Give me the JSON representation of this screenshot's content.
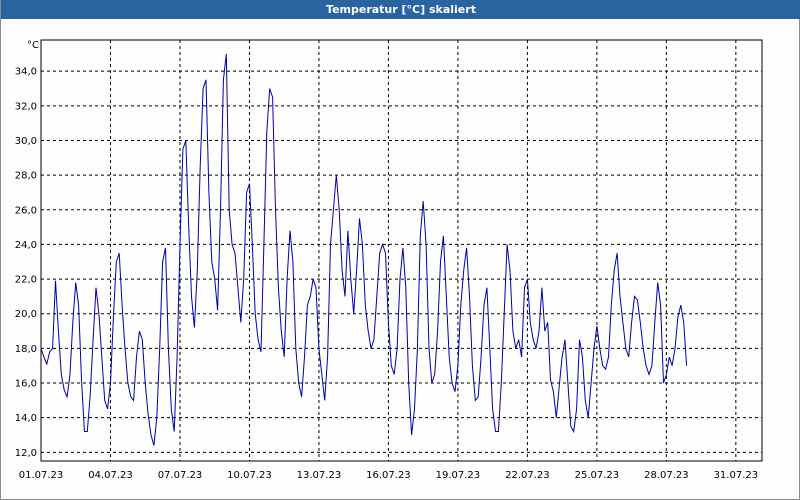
{
  "window": {
    "title": "Temperatur [°C] skaliert"
  },
  "chart_data": {
    "type": "line",
    "title": "Temperatur [°C] skaliert",
    "ylabel": "°C",
    "xlabel": "",
    "ylim": [
      11.5,
      35.8
    ],
    "grid": true,
    "x_ticks": [
      "01.07.23",
      "04.07.23",
      "07.07.23",
      "10.07.23",
      "13.07.23",
      "16.07.23",
      "19.07.23",
      "22.07.23",
      "25.07.23",
      "28.07.23",
      "31.07.23"
    ],
    "y_ticks": [
      "12,0",
      "14,0",
      "16,0",
      "18,0",
      "20,0",
      "22,0",
      "24,0",
      "26,0",
      "28,0",
      "30,0",
      "32,0",
      "34,0"
    ],
    "line_color": "#0000a8",
    "series": [
      {
        "x_start_day": 0,
        "step_hours": 3,
        "values": [
          18.0,
          17.5,
          17.1,
          17.8,
          18.0,
          21.9,
          19.0,
          16.5,
          15.6,
          15.2,
          16.5,
          19.5,
          21.8,
          20.5,
          16.2,
          13.2,
          13.2,
          15.3,
          18.5,
          21.5,
          20.0,
          17.5,
          15.0,
          14.5,
          16.0,
          19.8,
          23.0,
          23.5,
          20.5,
          18.0,
          16.0,
          15.2,
          15.0,
          17.5,
          19.0,
          18.5,
          16.0,
          14.2,
          13.0,
          12.4,
          14.0,
          18.0,
          23.0,
          23.8,
          18.0,
          14.5,
          13.2,
          17.5,
          24.0,
          29.5,
          30.0,
          25.0,
          21.0,
          19.2,
          22.5,
          28.5,
          33.0,
          33.5,
          27.0,
          23.0,
          22.0,
          20.2,
          26.0,
          33.5,
          35.0,
          26.0,
          24.0,
          23.5,
          21.5,
          19.5,
          22.0,
          27.0,
          27.5,
          24.0,
          20.0,
          18.5,
          17.8,
          24.0,
          30.5,
          33.0,
          32.5,
          26.0,
          21.5,
          19.0,
          17.5,
          22.0,
          24.8,
          23.0,
          18.0,
          16.0,
          15.2,
          17.5,
          20.5,
          21.0,
          22.0,
          21.5,
          18.0,
          16.5,
          15.0,
          17.5,
          24.0,
          26.0,
          28.0,
          26.0,
          22.5,
          21.0,
          24.8,
          22.0,
          20.0,
          22.5,
          25.5,
          24.0,
          20.5,
          19.0,
          18.0,
          18.5,
          21.0,
          23.5,
          24.0,
          23.5,
          19.5,
          17.0,
          16.5,
          18.0,
          22.0,
          23.8,
          21.5,
          16.0,
          13.0,
          14.5,
          18.0,
          24.5,
          26.5,
          24.0,
          18.0,
          16.0,
          16.5,
          19.0,
          23.0,
          24.5,
          21.0,
          17.5,
          16.0,
          15.5,
          17.0,
          20.5,
          22.5,
          23.8,
          21.0,
          17.0,
          15.0,
          15.2,
          17.5,
          20.5,
          21.5,
          18.0,
          14.5,
          13.2,
          13.2,
          16.0,
          20.0,
          24.0,
          22.5,
          19.0,
          18.0,
          18.5,
          17.5,
          21.5,
          22.0,
          19.5,
          18.5,
          18.0,
          19.0,
          21.5,
          19.0,
          19.5,
          16.2,
          15.5,
          14.0,
          15.8,
          17.5,
          18.5,
          16.0,
          13.5,
          13.2,
          14.5,
          18.5,
          17.5,
          15.0,
          14.0,
          16.0,
          18.0,
          19.3,
          18.0,
          17.0,
          16.8,
          17.5,
          20.5,
          22.5,
          23.5,
          21.0,
          19.5,
          18.0,
          17.5,
          19.5,
          21.0,
          20.8,
          19.5,
          18.0,
          17.0,
          16.5,
          17.0,
          19.5,
          21.8,
          20.5,
          16.0,
          16.5,
          17.5,
          17.0,
          18.0,
          19.8,
          20.5,
          19.5,
          17.0
        ]
      }
    ]
  }
}
